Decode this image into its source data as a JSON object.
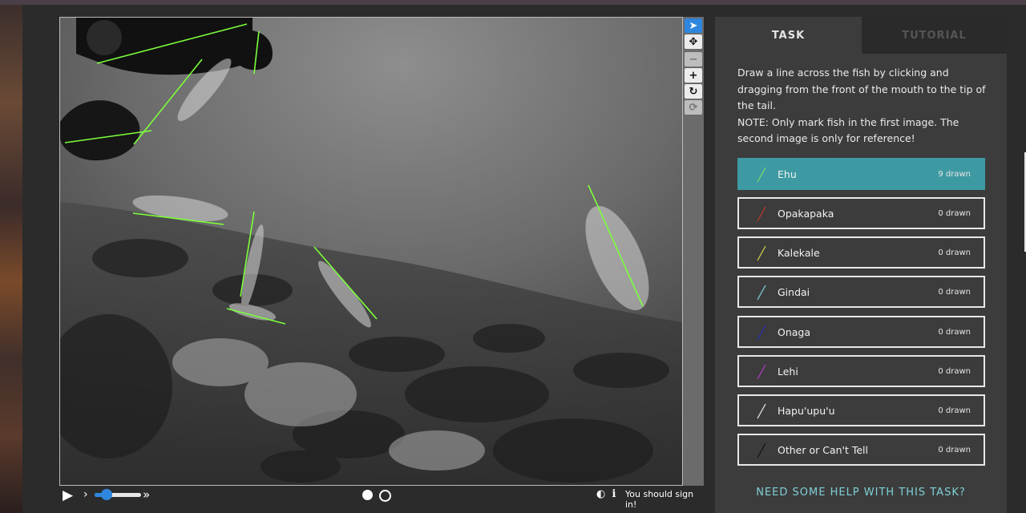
{
  "player": {
    "signin_text": "You should sign in!"
  },
  "panel": {
    "tabs": [
      {
        "label": "TASK"
      },
      {
        "label": "TUTORIAL"
      }
    ],
    "instructions": [
      "Draw a line across the fish by clicking and dragging from the front of the mouth to the tip of the tail.",
      "NOTE: Only mark fish in the first image. The second image is only for reference!"
    ],
    "choices": [
      {
        "label": "Ehu",
        "count": "9 drawn",
        "color": "#7ddb6c"
      },
      {
        "label": "Opakapaka",
        "count": "0 drawn",
        "color": "#c0392b"
      },
      {
        "label": "Kalekale",
        "count": "0 drawn",
        "color": "#d4d44a"
      },
      {
        "label": "Gindai",
        "count": "0 drawn",
        "color": "#7fd7e0"
      },
      {
        "label": "Onaga",
        "count": "0 drawn",
        "color": "#2a2ab8"
      },
      {
        "label": "Lehi",
        "count": "0 drawn",
        "color": "#b03fc8"
      },
      {
        "label": "Hapu'upu'u",
        "count": "0 drawn",
        "color": "#f0f0f0"
      },
      {
        "label": "Other or Can't Tell",
        "count": "0 drawn",
        "color": "#111111"
      }
    ],
    "help_text": "NEED SOME HELP WITH THIS TASK?"
  },
  "colors": {
    "accent": "#3e9aa2",
    "annotation_line": "#7dff3c",
    "tool_active": "#2e86de"
  },
  "playback": {
    "volume_level": 0.15,
    "frames_total": 2,
    "current_frame": 1
  }
}
